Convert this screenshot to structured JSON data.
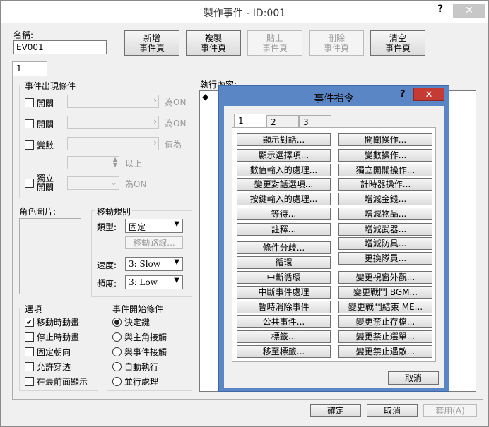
{
  "window": {
    "title": "製作事件 - ID:001",
    "help_label": "?",
    "close_label": "✕"
  },
  "name_label": "名稱:",
  "name_value": "EV001",
  "toolbar": {
    "new_page": [
      "新增",
      "事件頁"
    ],
    "copy_page": [
      "複製",
      "事件頁"
    ],
    "paste_page": [
      "貼上",
      "事件頁"
    ],
    "delete_page": [
      "刪除",
      "事件頁"
    ],
    "clear_page": [
      "清空",
      "事件頁"
    ]
  },
  "page_tab": "1",
  "conditions": {
    "title": "事件出現條件",
    "switch1": "開關",
    "switch2": "開關",
    "variable": "變數",
    "self_switch": [
      "獨立",
      "開關"
    ],
    "is_on": "為ON",
    "is_value": "值為",
    "or_above": "以上"
  },
  "graphic_label": "角色圖片:",
  "movement": {
    "title": "移動規則",
    "type_label": "類型:",
    "type_value": "固定",
    "route_button": "移動路線...",
    "speed_label": "速度:",
    "speed_value": "3: Slow",
    "freq_label": "頻度:",
    "freq_value": "3: Low"
  },
  "options": {
    "title": "選項",
    "items": [
      {
        "label": "移動時動畫",
        "checked": "✔"
      },
      {
        "label": "停止時動畫",
        "checked": ""
      },
      {
        "label": "固定朝向",
        "checked": ""
      },
      {
        "label": "允許穿透",
        "checked": ""
      },
      {
        "label": "在最前面顯示",
        "checked": ""
      }
    ]
  },
  "trigger": {
    "title": "事件開始條件",
    "items": [
      "決定鍵",
      "與主角接觸",
      "與事件接觸",
      "自動執行",
      "並行處理"
    ]
  },
  "contents_label": "執行內容:",
  "contents_marker": "◆",
  "buttons": {
    "ok": "確定",
    "cancel": "取消",
    "apply": "套用(A)"
  },
  "dialog": {
    "title": "事件指令",
    "help": "?",
    "close": "✕",
    "tabs": [
      "1",
      "2",
      "3"
    ],
    "left": [
      "顯示對話...",
      "顯示選擇項...",
      "數值輸入的處理...",
      "變更對話選項...",
      "按鍵輸入的處理...",
      "等待...",
      "註釋...",
      "條件分歧...",
      "循環",
      "中斷循環",
      "中斷事件處理",
      "暫時消除事件",
      "公共事件...",
      "標籤...",
      "移至標籤..."
    ],
    "right": [
      "開關操作...",
      "變數操作...",
      "獨立開關操作...",
      "計時器操作...",
      "增減金錢...",
      "增減物品...",
      "增減武器...",
      "增減防具...",
      "更換隊員...",
      "變更視窗外觀...",
      "變更戰鬥 BGM...",
      "變更戰鬥結束 ME...",
      "變更禁止存檔...",
      "變更禁止選單...",
      "變更禁止遇敵..."
    ],
    "cancel": "取消"
  }
}
